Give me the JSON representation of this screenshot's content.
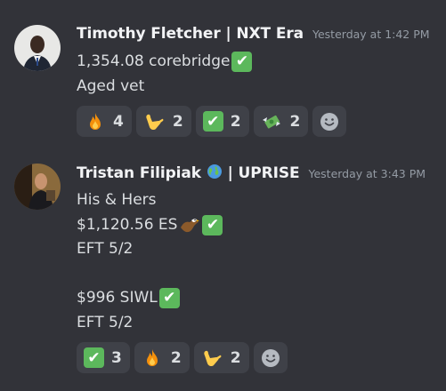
{
  "messages": [
    {
      "author": "Timothy Fletcher | NXT Era",
      "timestamp": "Yesterday at 1:42 PM",
      "lines": [
        "1,354.08 corebridge",
        "Aged vet"
      ],
      "reactions": [
        {
          "emoji": "fire-icon",
          "count": "4"
        },
        {
          "emoji": "call-me-hand-icon",
          "count": "2"
        },
        {
          "emoji": "check-mark-icon",
          "count": "2"
        },
        {
          "emoji": "money-with-wings-icon",
          "count": "2"
        }
      ]
    },
    {
      "author_name": "Tristan Filipiak",
      "author_suffix": "| UPRISE",
      "timestamp": "Yesterday at 3:43 PM",
      "lines": [
        "His & Hers",
        "$1,120.56 ES",
        "EFT 5/2",
        "",
        "$996 SIWL",
        "EFT 5/2"
      ],
      "reactions": [
        {
          "emoji": "check-mark-icon",
          "count": "3"
        },
        {
          "emoji": "fire-icon",
          "count": "2"
        },
        {
          "emoji": "call-me-hand-icon",
          "count": "2"
        }
      ]
    }
  ],
  "colors": {
    "background": "#323339",
    "reaction_bg": "#3f4148",
    "check_green": "#5cb85c",
    "username": "#f2f3f5",
    "timestamp": "#949ba4",
    "text": "#dbdee1"
  }
}
